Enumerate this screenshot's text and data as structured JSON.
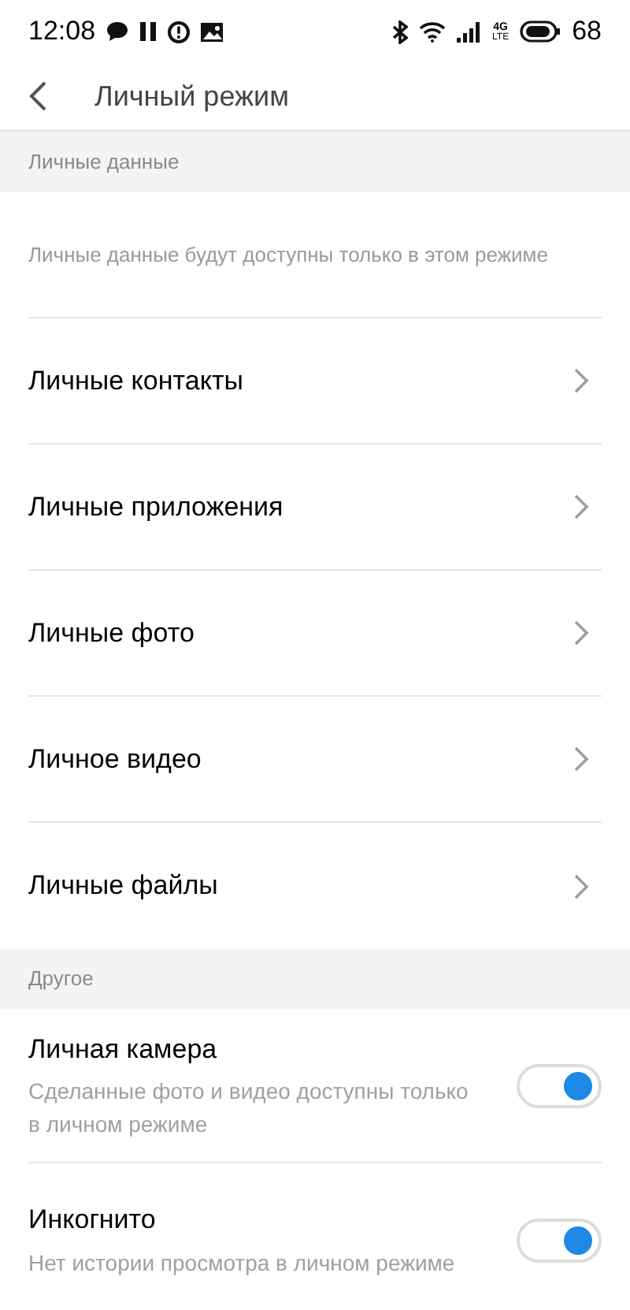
{
  "status_bar": {
    "time": "12:08",
    "network_type": "4G",
    "network_sub": "LTE",
    "battery": "68"
  },
  "header": {
    "title": "Личный режим"
  },
  "sections": [
    {
      "title": "Личные данные",
      "description": "Личные данные будут доступны только в этом режиме",
      "items": [
        {
          "kind": "link",
          "label": "Личные контакты"
        },
        {
          "kind": "link",
          "label": "Личные приложения"
        },
        {
          "kind": "link",
          "label": "Личные фото"
        },
        {
          "kind": "link",
          "label": "Личное видео"
        },
        {
          "kind": "link",
          "label": "Личные файлы"
        }
      ]
    },
    {
      "title": "Другое",
      "items": [
        {
          "kind": "toggle",
          "label": "Личная камера",
          "subtitle": "Сделанные фото и видео доступны только в личном режиме",
          "on": true
        },
        {
          "kind": "toggle",
          "label": "Инкогнито",
          "subtitle": "Нет истории просмотра в личном режиме",
          "on": true
        }
      ]
    }
  ]
}
